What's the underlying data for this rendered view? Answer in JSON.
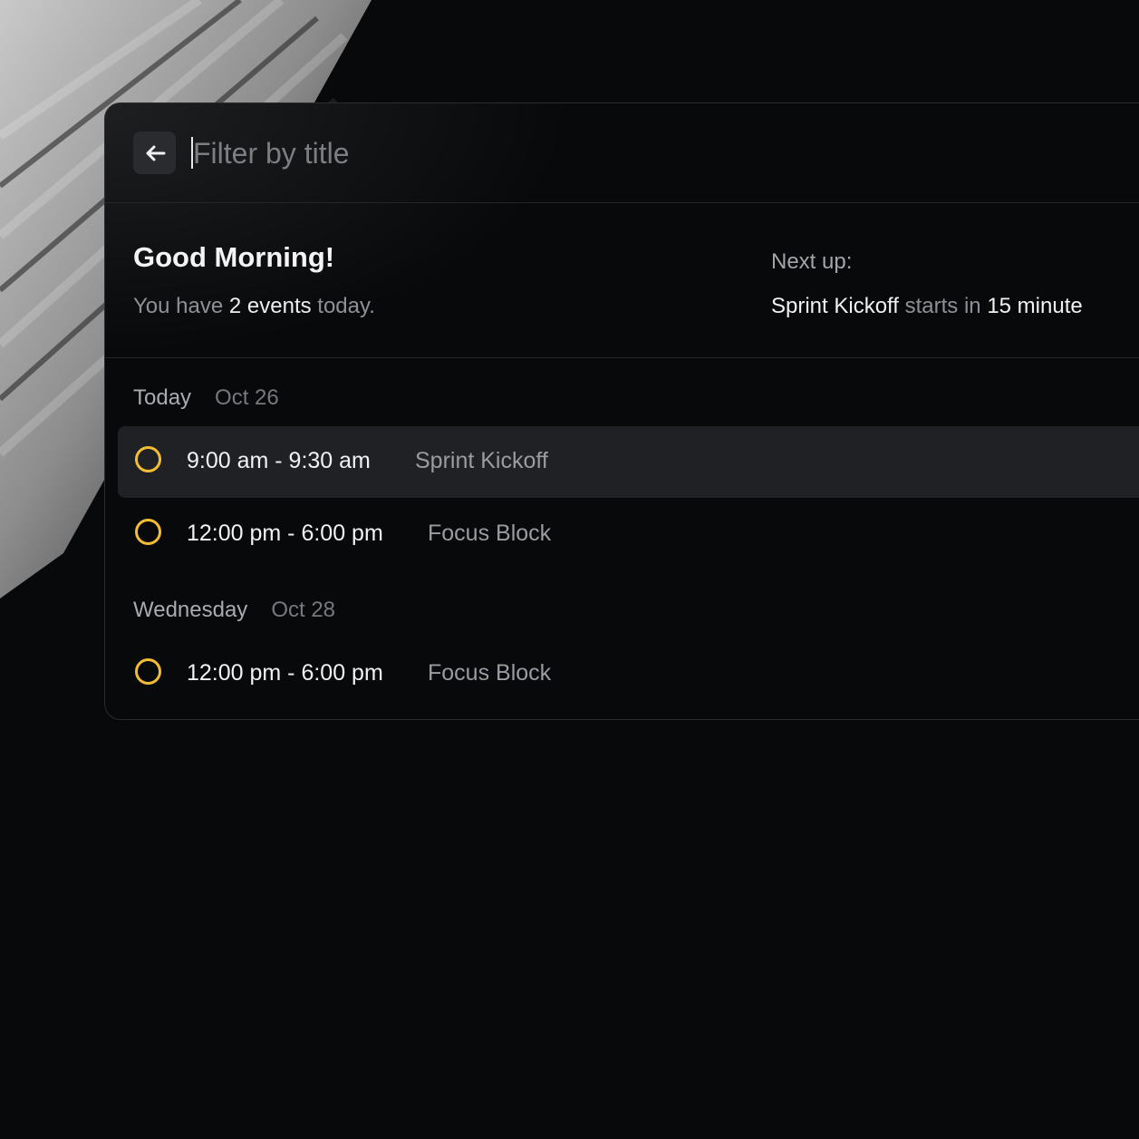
{
  "search": {
    "placeholder": "Filter by title",
    "value": ""
  },
  "summary": {
    "greeting": "Good Morning!",
    "events_prefix": "You have ",
    "events_count": "2 events",
    "events_suffix": " today.",
    "next_label": "Next up:",
    "next_event": "Sprint Kickoff",
    "next_mid": " starts in ",
    "next_time": "15 minute"
  },
  "days": [
    {
      "name": "Today",
      "date": "Oct 26",
      "events": [
        {
          "time": "9:00 am - 9:30 am",
          "title": "Sprint Kickoff",
          "selected": true
        },
        {
          "time": "12:00 pm - 6:00 pm",
          "title": "Focus Block",
          "selected": false
        }
      ]
    },
    {
      "name": "Wednesday",
      "date": "Oct 28",
      "events": [
        {
          "time": "12:00 pm - 6:00 pm",
          "title": "Focus Block",
          "selected": false
        }
      ]
    }
  ],
  "colors": {
    "accent_ring": "#f2bd34",
    "background": "#08090b",
    "selected_row": "#202124"
  },
  "icons": {
    "back": "arrow-left-icon",
    "event_status": "circle-outline-icon"
  }
}
